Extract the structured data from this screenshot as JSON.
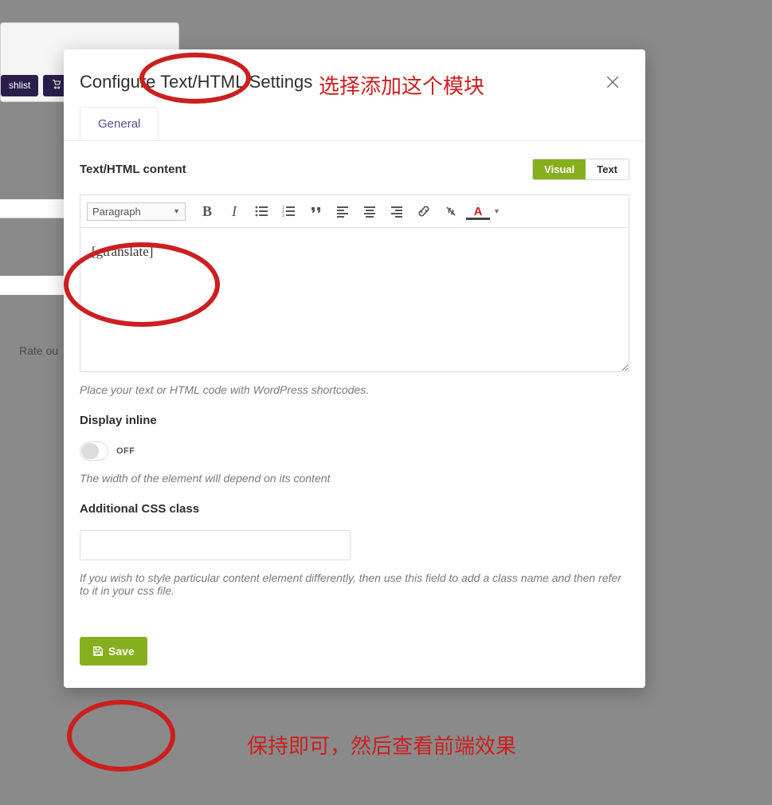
{
  "background": {
    "wishlist_btn": "shlist",
    "rate_label": "Rate ou"
  },
  "modal": {
    "title": "Configure Text/HTML Settings",
    "tabs": {
      "general": "General"
    }
  },
  "content": {
    "label": "Text/HTML content",
    "view_toggle": {
      "visual": "Visual",
      "text": "Text"
    },
    "paragraph_selector": "Paragraph",
    "body_text": "[gtranslate]",
    "hint": "Place your text or HTML code with WordPress shortcodes."
  },
  "display_inline": {
    "label": "Display inline",
    "state_text": "OFF",
    "hint": "The width of the element will depend on its content"
  },
  "css_class": {
    "label": "Additional CSS class",
    "value": "",
    "hint": "If you wish to style particular content element differently, then use this field to add a class name and then refer to it in your css file."
  },
  "footer": {
    "save_label": "Save"
  },
  "annotations": {
    "top_note": "选择添加这个模块",
    "bottom_note": "保持即可，然后查看前端效果"
  },
  "colors": {
    "accent": "#86af1d",
    "annotation": "#cc1f1f"
  }
}
